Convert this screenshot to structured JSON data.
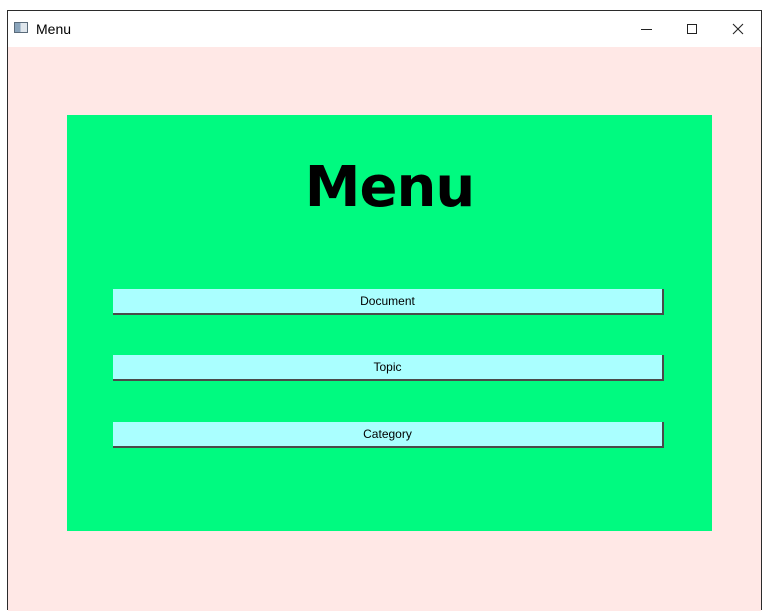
{
  "window": {
    "title": "Menu"
  },
  "panel": {
    "heading": "Menu",
    "buttons": [
      {
        "label": "Document"
      },
      {
        "label": "Topic"
      },
      {
        "label": "Category"
      }
    ]
  },
  "colors": {
    "client_background": "#ffe8e6",
    "panel_background": "#00fa80",
    "button_background": "#aaffff"
  },
  "icons": {
    "app": "app-icon",
    "minimize": "minimize-icon",
    "maximize": "maximize-icon",
    "close": "close-icon"
  }
}
